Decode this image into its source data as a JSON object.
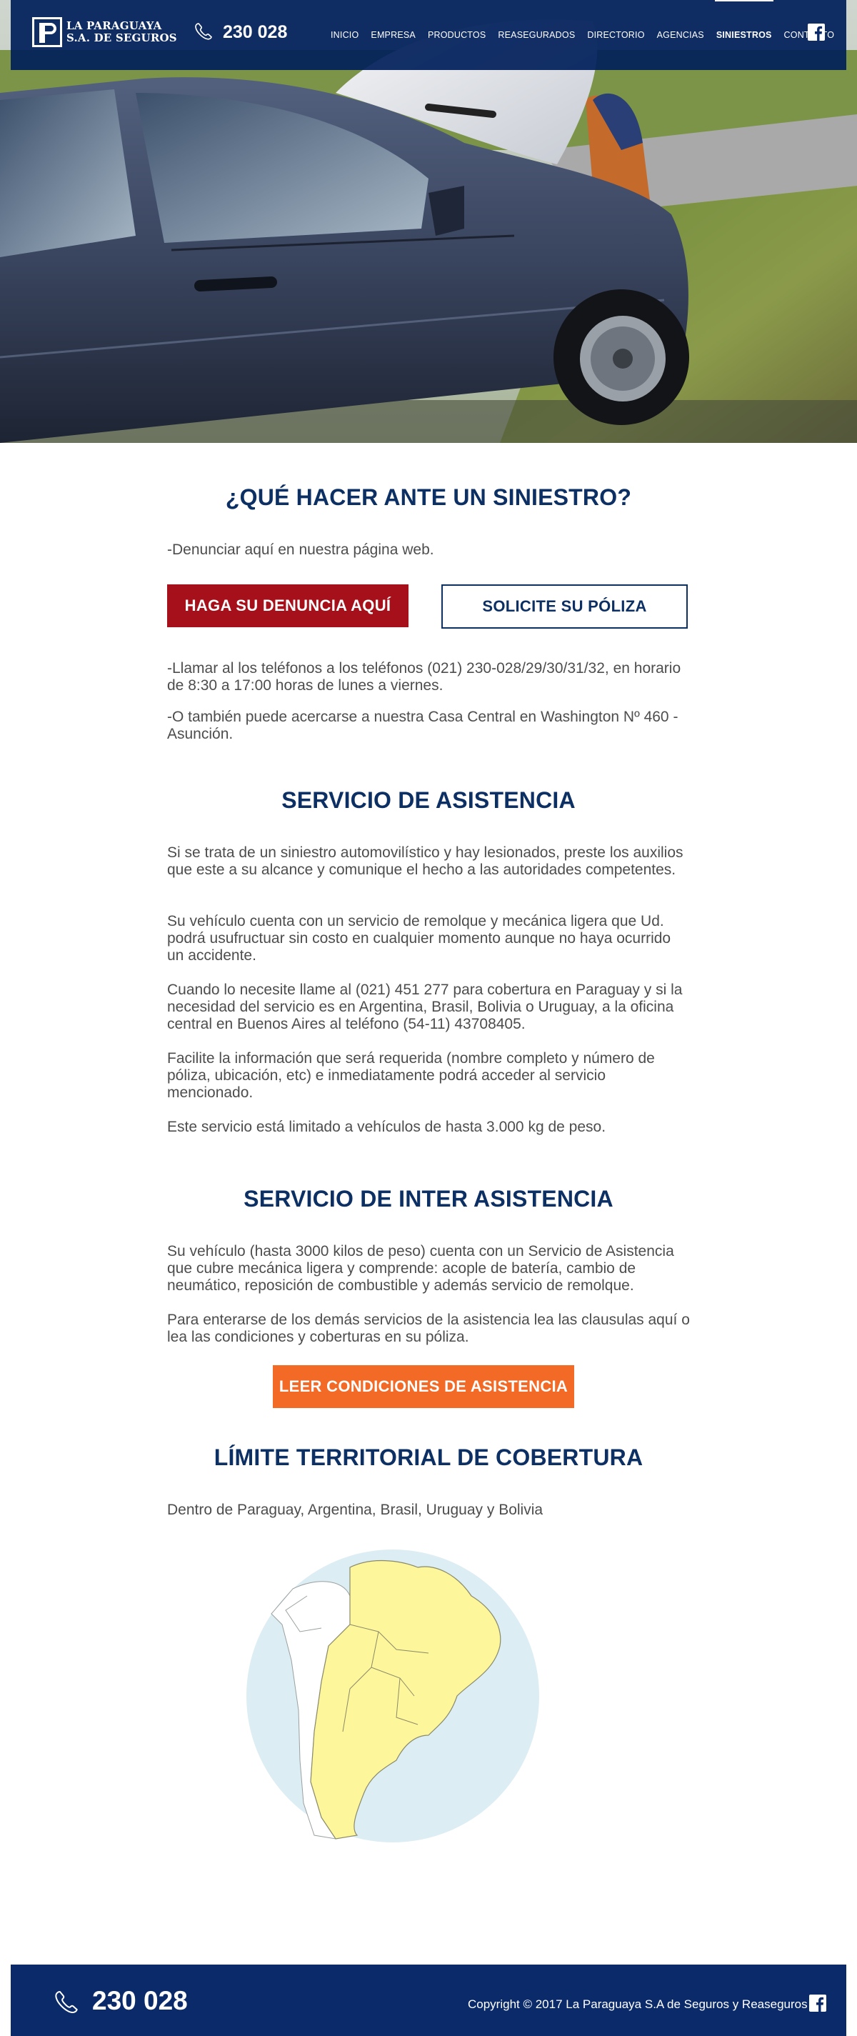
{
  "header": {
    "logo_line1": "LA PARAGUAYA",
    "logo_line2": "S.A. DE SEGUROS",
    "phone": "230 028",
    "nav": [
      {
        "label": "INICIO"
      },
      {
        "label": "EMPRESA"
      },
      {
        "label": "PRODUCTOS"
      },
      {
        "label": "REASEGURADOS"
      },
      {
        "label": "DIRECTORIO"
      },
      {
        "label": "AGENCIAS"
      },
      {
        "label": "SINIESTROS",
        "active": true
      },
      {
        "label": "CONTACTO"
      }
    ],
    "social_icon": "facebook-icon"
  },
  "section1": {
    "title": "¿QUÉ HACER ANTE UN SINIESTRO?",
    "intro": "-Denunciar aquí en nuestra página web.",
    "btn_denuncia": "HAGA SU DENUNCIA AQUÍ",
    "btn_poliza": "SOLICITE SU PÓLIZA",
    "p1": "-Llamar al los teléfonos a los teléfonos (021) 230-028/29/30/31/32, en horario de 8:30 a 17:00 horas de lunes a viernes.",
    "p2": "-O también puede acercarse a nuestra Casa Central en Washington Nº 460 - Asunción."
  },
  "section2": {
    "title": "SERVICIO DE ASISTENCIA",
    "p1": "Si se trata de un siniestro automovilístico y hay lesionados, preste los auxilios que este a su alcance y comunique el hecho a las autoridades competentes.",
    "p2": "Su vehículo cuenta con un servicio de remolque y mecánica ligera que Ud. podrá usufructuar sin costo en cualquier momento aunque no haya ocurrido un accidente.",
    "p3": "Cuando lo necesite llame al (021) 451 277 para cobertura en Paraguay y si la necesidad del servicio es en Argentina, Brasil, Bolivia o Uruguay, a la oficina central en Buenos Aires al teléfono (54-11) 43708405.",
    "p4": "Facilite la información que será requerida (nombre completo y número de póliza, ubicación, etc) e inmediatamente podrá acceder al servicio mencionado.",
    "p5": "Este servicio está limitado a vehículos de hasta 3.000 kg de peso."
  },
  "section3": {
    "title": "SERVICIO DE INTER ASISTENCIA",
    "p1": "Su vehículo (hasta 3000 kilos de peso) cuenta con un Servicio de Asistencia que cubre mecánica ligera y comprende: acople de batería, cambio de neumático, reposición de combustible y además servicio de remolque.",
    "p2": "Para enterarse de los demás servicios de la asistencia lea las clausulas aquí o lea las condiciones y coberturas en su póliza.",
    "btn_condiciones": "LEER CONDICIONES DE ASISTENCIA"
  },
  "section4": {
    "title": "LÍMITE TERRITORIAL DE COBERTURA",
    "p1": "Dentro de Paraguay, Argentina, Brasil, Uruguay y Bolivia"
  },
  "footer": {
    "phone": "230 028",
    "copyright": "Copyright © 2017 La Paraguaya S.A de Seguros y Reaseguros",
    "social_icon": "facebook-icon"
  },
  "colors": {
    "navy": "#0c2f64",
    "red": "#a5101a",
    "orange": "#f26a26",
    "map_ocean": "#dcedf3",
    "map_covered": "#fdf69a"
  }
}
